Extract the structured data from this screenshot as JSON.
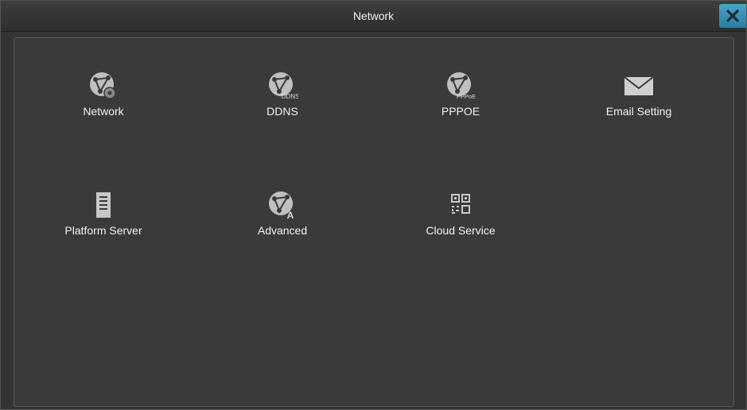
{
  "window": {
    "title": "Network",
    "close_icon": "close-icon",
    "accent": "#3a93bd"
  },
  "tiles": [
    {
      "label": "Network",
      "icon": "network-settings-icon"
    },
    {
      "label": "DDNS",
      "icon": "ddns-icon"
    },
    {
      "label": "PPPOE",
      "icon": "pppoe-icon"
    },
    {
      "label": "Email Setting",
      "icon": "envelope-icon"
    },
    {
      "label": "Platform Server",
      "icon": "server-icon"
    },
    {
      "label": "Advanced",
      "icon": "advanced-network-icon"
    },
    {
      "label": "Cloud Service",
      "icon": "qr-code-icon"
    }
  ],
  "icon_text": {
    "ddns": "DDNS",
    "pppoe": "PPPoE",
    "advanced": "A"
  }
}
